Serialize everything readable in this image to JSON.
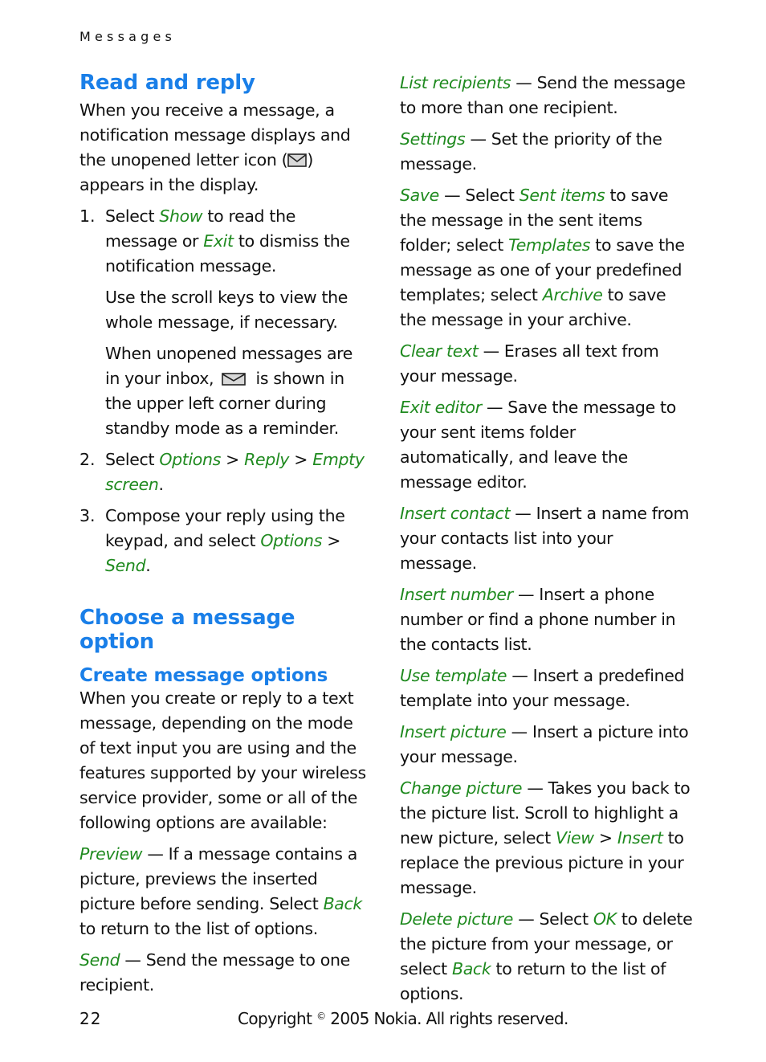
{
  "running_header": "Messages",
  "section_read_reply": {
    "title": "Read and reply",
    "intro": {
      "before_icon": "When you receive a message, a notification message displays and the unopened letter icon (",
      "icon": "unopened-letter-icon",
      "after_icon": ") appears in the display."
    },
    "steps": [
      {
        "number": "1.",
        "line": {
          "t1": "Select ",
          "k1": "Show",
          "t2": " to read the message or ",
          "k2": "Exit",
          "t3": " to dismiss the notification message."
        },
        "note1": "Use the scroll keys to view the whole message, if necessary.",
        "note2": {
          "before_icon": "When unopened messages are in your inbox, ",
          "icon": "unopened-letter-icon",
          "after_icon": " is shown in the upper left corner during standby mode as a reminder."
        }
      },
      {
        "number": "2.",
        "t1": "Select ",
        "k1": "Options",
        "sep1": " > ",
        "k2": "Reply",
        "sep2": " > ",
        "k3": "Empty screen",
        "t2": "."
      },
      {
        "number": "3.",
        "t1": "Compose your reply using the keypad, and select ",
        "k1": "Options",
        "sep1": " > ",
        "k2": "Send",
        "t2": "."
      }
    ]
  },
  "section_choose_option": {
    "title": "Choose a message option",
    "subtitle": "Create message options",
    "intro": "When you create or reply to a text message, depending on the mode of text input you are using and the features supported by your wireless service provider, some or all of the following options are available:",
    "options": [
      {
        "name": "Preview",
        "desc_before": " — If a message contains a picture, previews the inserted picture before sending. Select ",
        "k1": "Back",
        "desc_after": " to return to the list of options."
      },
      {
        "name": "Send",
        "desc_before": " — Send the message to one recipient."
      },
      {
        "name": "List recipients",
        "desc_before": " — Send the message to more than one recipient."
      },
      {
        "name": "Settings",
        "desc_before": " — Set the priority of the message."
      },
      {
        "name": "Save",
        "desc_before": " — Select ",
        "k1": "Sent items",
        "mid1": " to save the message in the sent items folder; select ",
        "k2": "Templates",
        "mid2": " to save the message as one of your predefined templates; select ",
        "k3": "Archive",
        "desc_after": " to save the message in your archive."
      },
      {
        "name": "Clear text",
        "desc_before": " — Erases all text from your message."
      },
      {
        "name": "Exit editor",
        "desc_before": " — Save the message to your sent items folder automatically, and leave the message editor."
      },
      {
        "name": "Insert contact",
        "desc_before": " — Insert a name from your contacts list into your message."
      },
      {
        "name": "Insert number",
        "desc_before": " — Insert a phone number or find a phone number in the contacts list."
      },
      {
        "name": "Use template",
        "desc_before": " — Insert a predefined template into your message."
      },
      {
        "name": "Insert picture",
        "desc_before": " — Insert a picture into your message."
      },
      {
        "name": "Change picture",
        "desc_before": " — Takes you back to the picture list. Scroll to highlight a new picture, select ",
        "k1": "View",
        "mid1": " > ",
        "k2": "Insert",
        "desc_after": " to replace the previous picture in your message."
      },
      {
        "name": "Delete picture",
        "desc_before": " — Select ",
        "k1": "OK",
        "mid1": " to delete the picture from your message, or select ",
        "k2": "Back",
        "desc_after": " to return to the list of options."
      }
    ]
  },
  "footer": {
    "page_number": "22",
    "copyright_prefix": "Copyright ",
    "copyright_symbol": "©",
    "copyright_suffix": " 2005 Nokia. All rights reserved."
  },
  "colors": {
    "heading": "#1a7fe8",
    "keyword": "#1f8a1f",
    "body_text": "#111111"
  }
}
